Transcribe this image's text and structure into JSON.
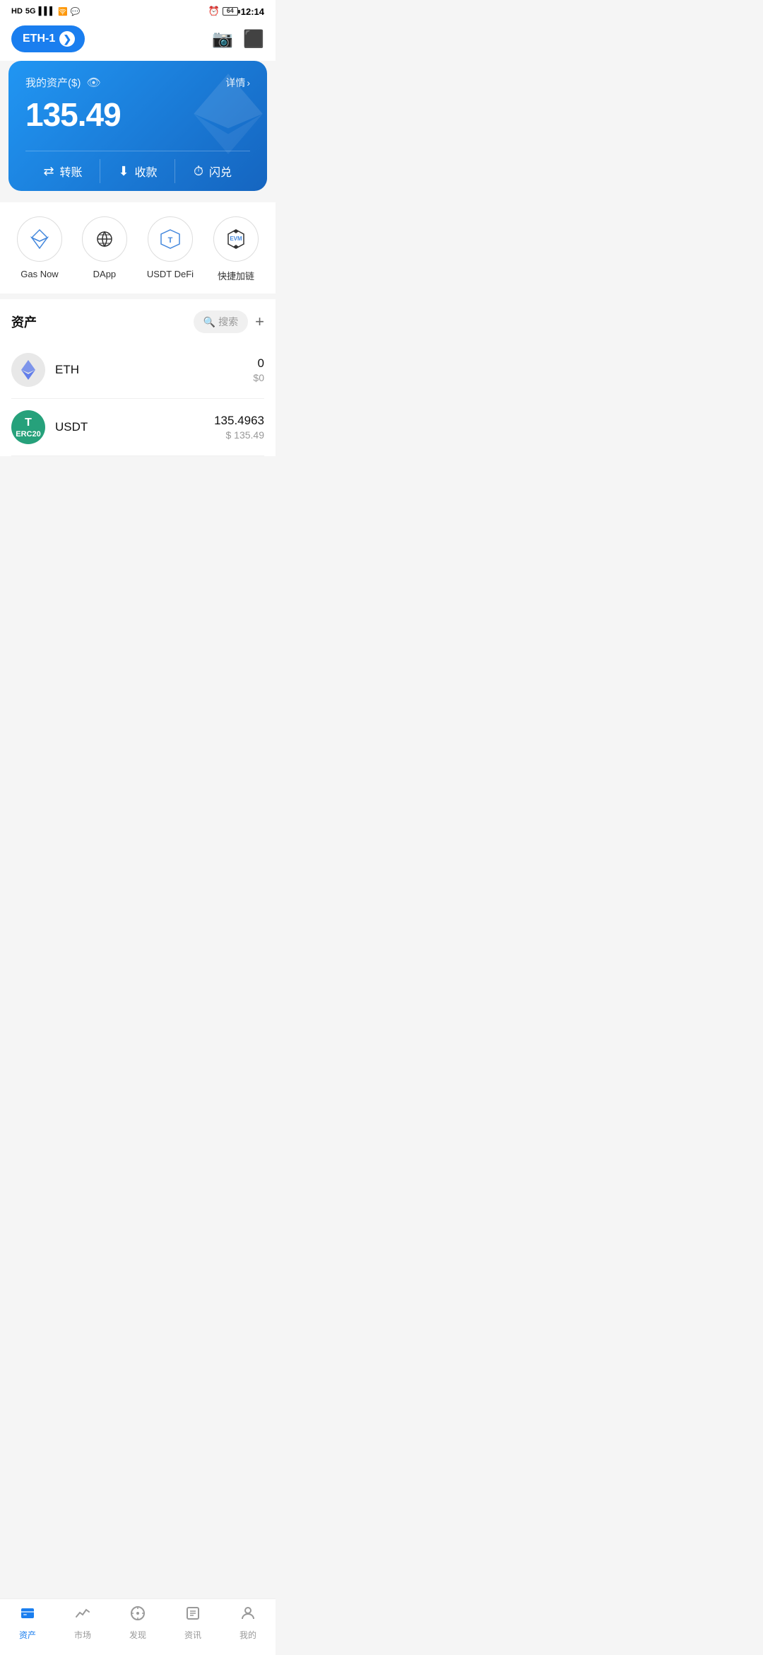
{
  "statusBar": {
    "left": "HD 5G",
    "time": "12:14",
    "battery": "64"
  },
  "topNav": {
    "networkLabel": "ETH-1",
    "walletIcon": "👛",
    "scanIcon": "⬜"
  },
  "assetCard": {
    "label": "我的资产($)",
    "detailLink": "详情",
    "amount": "135.49",
    "actions": [
      {
        "icon": "⇄",
        "label": "转账"
      },
      {
        "icon": "⬇",
        "label": "收款"
      },
      {
        "icon": "⏱",
        "label": "闪兑"
      }
    ]
  },
  "quickMenu": {
    "items": [
      {
        "label": "Gas Now",
        "icon": "◈"
      },
      {
        "label": "DApp",
        "icon": "◎"
      },
      {
        "label": "USDT DeFi",
        "icon": "◆"
      },
      {
        "label": "快捷加链",
        "icon": "EVM"
      }
    ]
  },
  "assets": {
    "title": "资产",
    "searchPlaceholder": "搜索",
    "tokens": [
      {
        "name": "ETH",
        "amount": "0",
        "usd": "$0"
      },
      {
        "name": "USDT",
        "amount": "135.4963",
        "usd": "$135.49"
      }
    ]
  },
  "bottomNav": {
    "items": [
      {
        "label": "资产",
        "active": true
      },
      {
        "label": "市场",
        "active": false
      },
      {
        "label": "发现",
        "active": false
      },
      {
        "label": "资讯",
        "active": false
      },
      {
        "label": "我的",
        "active": false
      }
    ]
  }
}
